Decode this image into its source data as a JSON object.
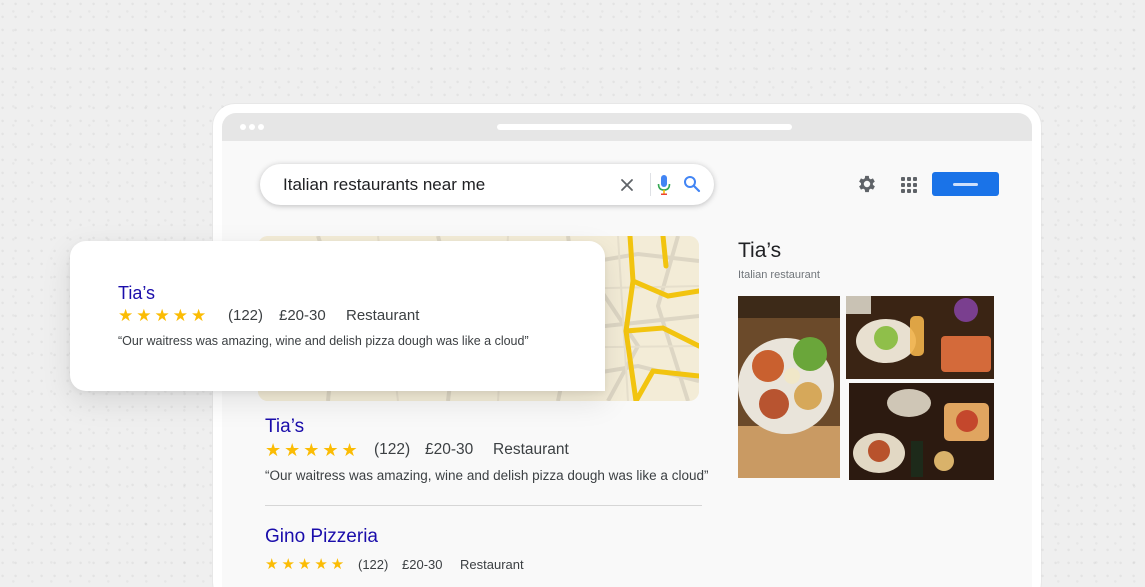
{
  "search": {
    "query": "Italian restaurants near me",
    "clear_icon": "close-icon",
    "mic_icon": "microphone-icon",
    "search_icon": "search-icon"
  },
  "toolbar": {
    "settings_icon": "gear-icon",
    "apps_icon": "apps-grid-icon",
    "accent_color": "#1a73e8"
  },
  "highlight_card": {
    "name": "Tia’s",
    "stars": "★★★★★",
    "rating_count": "(122)",
    "price": "£20-30",
    "category": "Restaurant",
    "review": "“Our waitress was amazing, wine and delish pizza dough was like a cloud”"
  },
  "results": [
    {
      "name": "Tia’s",
      "stars": "★★★★★",
      "rating_count": "(122)",
      "price": "£20-30",
      "category": "Restaurant",
      "review": "“Our waitress was amazing, wine and delish pizza dough was like a cloud”"
    },
    {
      "name": "Gino Pizzeria",
      "stars": "★★★★★",
      "rating_count": "(122)",
      "price": "£20-30",
      "category": "Restaurant"
    }
  ],
  "knowledge_panel": {
    "title": "Tia’s",
    "subtitle": "Italian restaurant"
  },
  "colors": {
    "link": "#1a0dab",
    "star": "#fbbc04",
    "map_road": "#f2c40f"
  }
}
